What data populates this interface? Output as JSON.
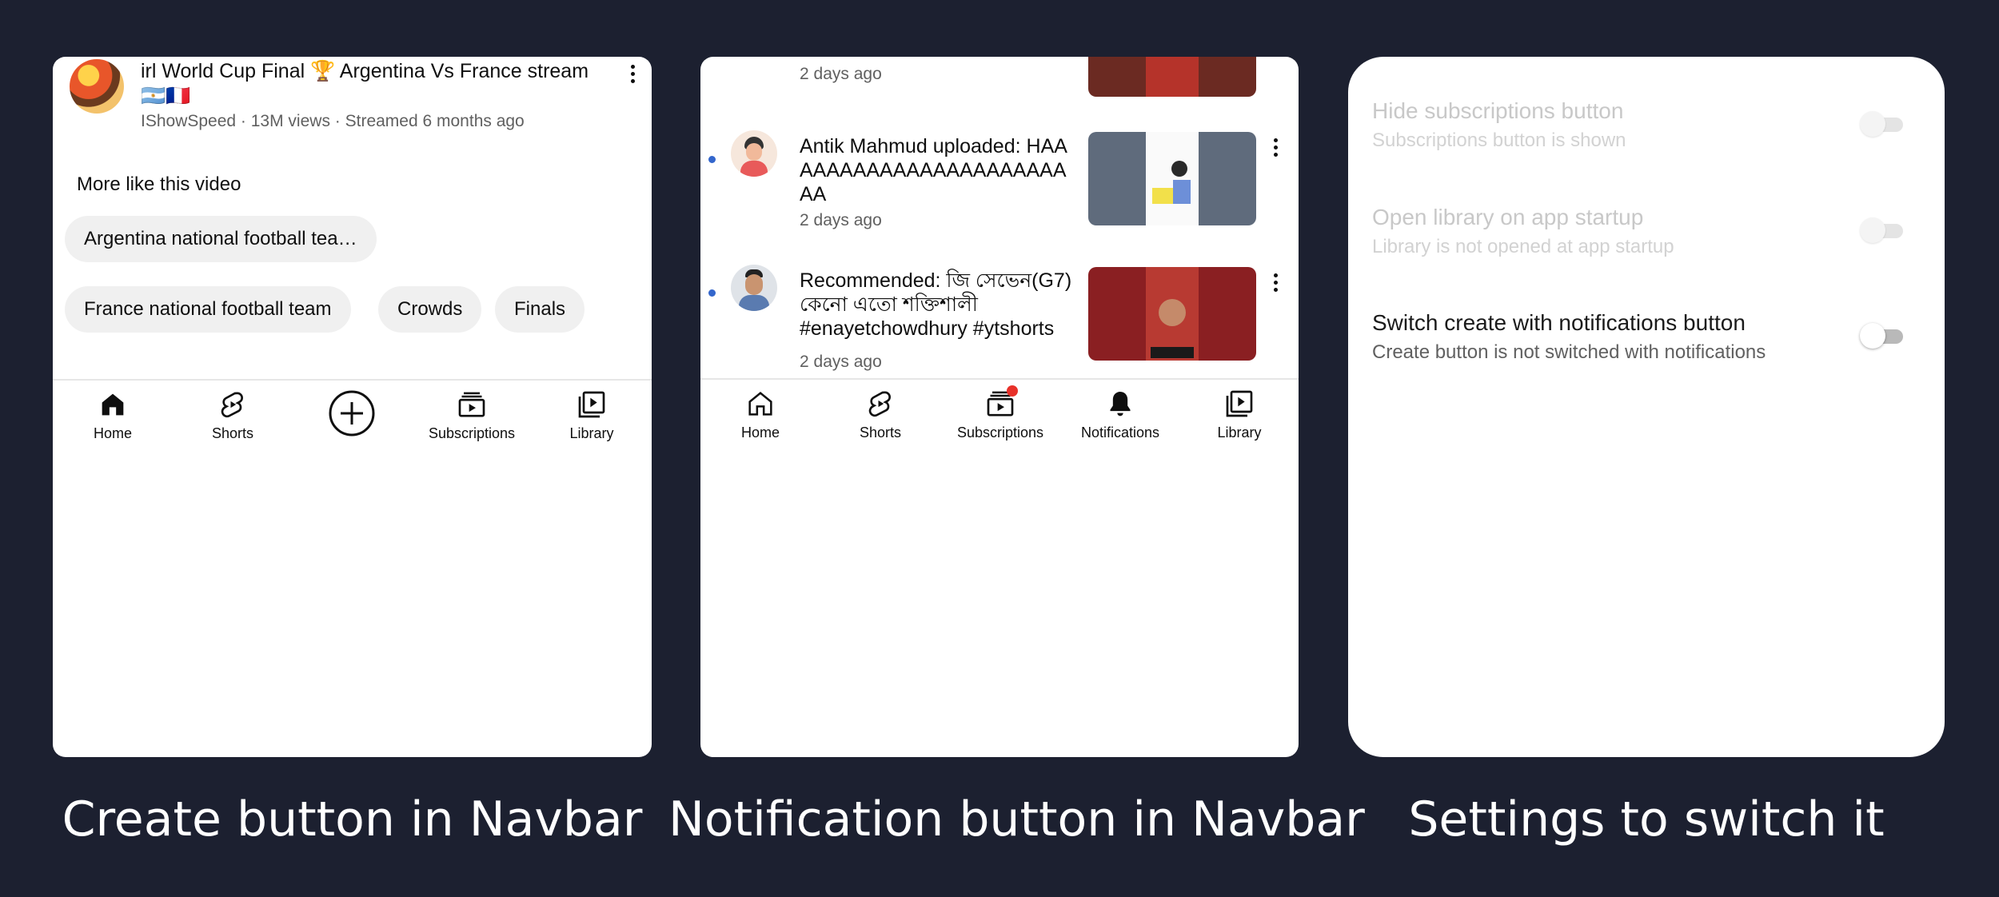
{
  "captions": {
    "left": "Create button in Navbar",
    "middle": "Notification button in Navbar",
    "right": "Settings to switch it"
  },
  "panel1": {
    "video_title": "irl World Cup Final 🏆 Argentina Vs France stream 🇦🇷🇫🇷",
    "video_meta": "IShowSpeed · 13M views · Streamed 6 months ago",
    "more_title": "More like this video",
    "chips": [
      "Argentina national football tea…",
      "France national football team",
      "Crowds",
      "Finals"
    ],
    "nav": {
      "home": "Home",
      "shorts": "Shorts",
      "subscriptions": "Subscriptions",
      "library": "Library"
    }
  },
  "panel2": {
    "notifications": [
      {
        "time": "2 days ago"
      },
      {
        "text": "Antik Mahmud uploaded: HAAAAAAAAAAAAAAAAAAAAAAAA",
        "time": "2 days ago"
      },
      {
        "text": "Recommended: জি সেভেন(G7) কেনো এতো শক্তিশালী #enayetchowdhury #ytshorts",
        "time": "2 days ago"
      }
    ],
    "nav": {
      "home": "Home",
      "shorts": "Shorts",
      "subscriptions": "Subscriptions",
      "notifications": "Notifications",
      "library": "Library"
    }
  },
  "panel3": {
    "settings": [
      {
        "title": "Hide subscriptions button",
        "subtitle": "Subscriptions button is shown",
        "enabled": false,
        "on": false
      },
      {
        "title": "Open library on app startup",
        "subtitle": "Library is not opened at app startup",
        "enabled": false,
        "on": false
      },
      {
        "title": "Switch create with notifications button",
        "subtitle": "Create button is not switched with notifications",
        "enabled": true,
        "on": false
      }
    ]
  },
  "colors": {
    "background": "#1c2030",
    "unread_dot": "#3366cc",
    "badge": "#e8312a",
    "disabled_text": "#c8c8c8"
  }
}
